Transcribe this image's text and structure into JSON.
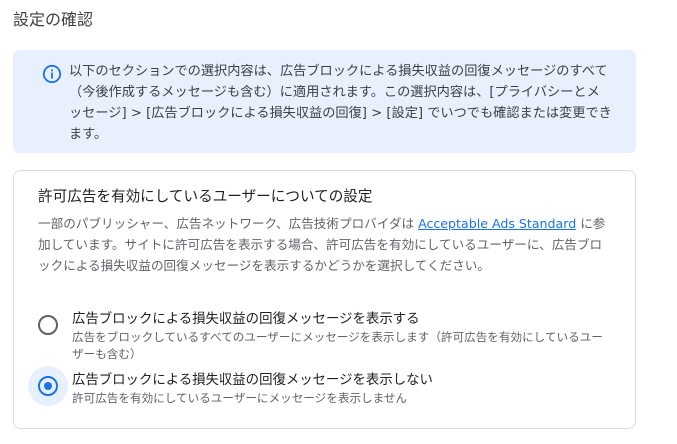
{
  "page": {
    "title": "設定の確認"
  },
  "info_banner": {
    "icon": "info-icon",
    "text": "以下のセクションでの選択内容は、広告ブロックによる損失収益の回復メッセージのすべて（今後作成するメッセージも含む）に適用されます。この選択内容は、[プライバシーとメッセージ] > [広告ブロックによる損失収益の回復] > [設定] でいつでも確認または変更できます。"
  },
  "allowlisted_ads_section": {
    "title": "許可広告を有効にしているユーザーについての設定",
    "description_before_link": "一部のパブリッシャー、広告ネットワーク、広告技術プロバイダは ",
    "link_text": "Acceptable Ads Standard",
    "description_after_link": " に参加しています。サイトに許可広告を表示する場合、許可広告を有効にしているユーザーに、広告ブロックによる損失収益の回復メッセージを表示するかどうかを選択してください。",
    "options": [
      {
        "label": "広告ブロックによる損失収益の回復メッセージを表示する",
        "sublabel": "広告をブロックしているすべてのユーザーにメッセージを表示します（許可広告を有効にしているユーザーも含む）",
        "selected": false
      },
      {
        "label": "広告ブロックによる損失収益の回復メッセージを表示しない",
        "sublabel": "許可広告を有効にしているユーザーにメッセージを表示しません",
        "selected": true
      }
    ]
  },
  "colors": {
    "accent": "#1a73e8",
    "banner_background": "#e8f0fe",
    "card_border": "#dadce0"
  }
}
